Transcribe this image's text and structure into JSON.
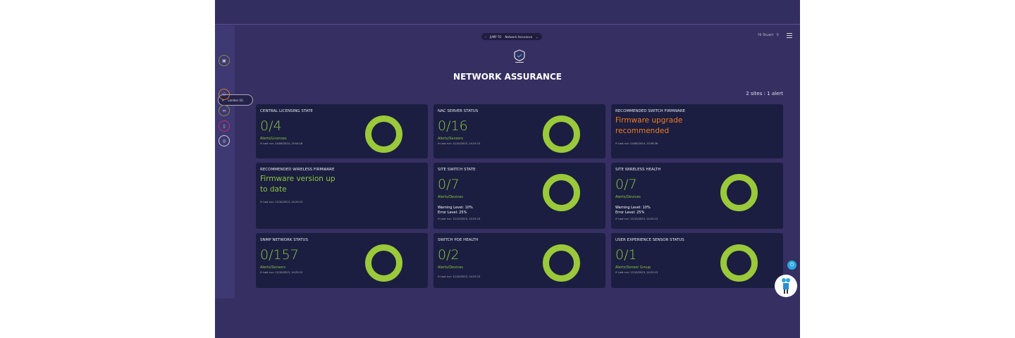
{
  "header": {
    "jump_to": "JUMP TO",
    "jump_value": "Network Assurance",
    "greeting": "Hi Stuart"
  },
  "sidebar": {
    "location": "London (0)"
  },
  "page": {
    "title": "NETWORK ASSURANCE",
    "summary": "2 sites : 1 alert"
  },
  "colors": {
    "ok": "#8bc53f",
    "warn": "#f07a22",
    "card": "#1b1e40",
    "bg": "#352f62"
  },
  "cards": [
    {
      "title": "CENTRAL LICENSING STATE",
      "value": "0/4",
      "unit": "Alerts/Licenses",
      "last_run": "Last run: 24/06/2024, 15:54:18"
    },
    {
      "title": "NAC SERVER STATUS",
      "value": "0/16",
      "unit": "Alerts/Sensors",
      "last_run": "Last run: 12/10/2023, 14:25:13"
    },
    {
      "title": "RECOMMENDED SWITCH FIRMWARE",
      "message": "Firmware upgrade recommended",
      "last_run": "Last run: 24/06/2024, 15:56:36"
    },
    {
      "title": "RECOMMENDED WIRELESS FIRMWARE",
      "message": "Firmware version up to date",
      "last_run": "Last run: 12/10/2023, 14:25:13"
    },
    {
      "title": "SITE SWITCH STATE",
      "value": "0/7",
      "unit": "Alerts/Devices",
      "warning": "Warning Level: 10%",
      "error": "Error Level: 25%",
      "last_run": "Last run: 12/10/2023, 14:25:13"
    },
    {
      "title": "SITE WIRELESS HEALTH",
      "value": "0/7",
      "unit": "Alerts/Devices",
      "warning": "Warning Level: 10%",
      "error": "Error Level: 25%",
      "last_run": "Last run: 12/10/2023, 14:25:13"
    },
    {
      "title": "SNMP NETWORK STATUS",
      "value": "0/157",
      "unit": "Alerts/Sensors",
      "last_run": "Last run: 12/10/2023, 14:25:13"
    },
    {
      "title": "SWITCH POE HEALTH",
      "value": "0/2",
      "unit": "Alerts/Devices",
      "last_run": "Last run: 12/10/2023, 14:25:13"
    },
    {
      "title": "USER EXPERIENCE SENSOR STATUS",
      "value": "0/1",
      "unit": "Alerts/Sensor Group",
      "last_run": "Last run: 12/10/2023, 14:25:13"
    }
  ]
}
